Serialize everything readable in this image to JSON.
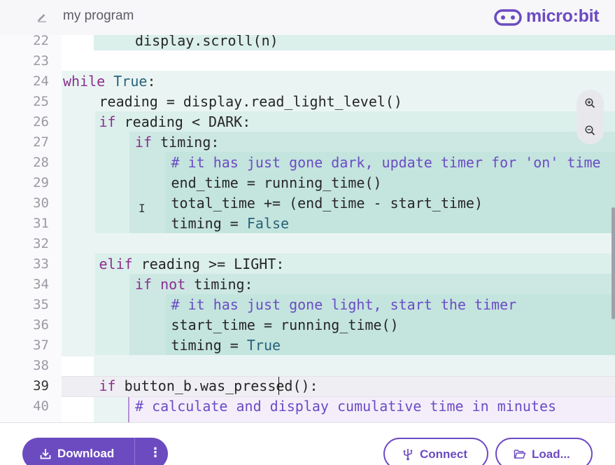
{
  "header": {
    "program_name": "my program",
    "brand": "micro:bit"
  },
  "code": [
    {
      "num": "22",
      "tokens": [
        {
          "t": "display.scroll(n)",
          "c": ""
        }
      ]
    },
    {
      "num": "23",
      "tokens": []
    },
    {
      "num": "24",
      "tokens": [
        {
          "t": "while",
          "c": "kw"
        },
        {
          "t": " ",
          "c": ""
        },
        {
          "t": "True",
          "c": "bi"
        },
        {
          "t": ":",
          "c": ""
        }
      ]
    },
    {
      "num": "25",
      "tokens": [
        {
          "t": "reading = display.read_light_level()",
          "c": ""
        }
      ]
    },
    {
      "num": "26",
      "tokens": [
        {
          "t": "if",
          "c": "kw"
        },
        {
          "t": " reading < DARK:",
          "c": ""
        }
      ]
    },
    {
      "num": "27",
      "tokens": [
        {
          "t": "if",
          "c": "kw"
        },
        {
          "t": " timing:",
          "c": ""
        }
      ]
    },
    {
      "num": "28",
      "tokens": [
        {
          "t": "# it has just gone dark, update timer for 'on' time",
          "c": "cm"
        }
      ]
    },
    {
      "num": "29",
      "tokens": [
        {
          "t": "end_time = running_time()",
          "c": ""
        }
      ]
    },
    {
      "num": "30",
      "tokens": [
        {
          "t": "total_time += (end_time - start_time)",
          "c": ""
        }
      ]
    },
    {
      "num": "31",
      "tokens": [
        {
          "t": "timing = ",
          "c": ""
        },
        {
          "t": "False",
          "c": "bi"
        }
      ]
    },
    {
      "num": "32",
      "tokens": []
    },
    {
      "num": "33",
      "tokens": [
        {
          "t": "elif",
          "c": "kw"
        },
        {
          "t": " reading >= LIGHT:",
          "c": ""
        }
      ]
    },
    {
      "num": "34",
      "tokens": [
        {
          "t": "if",
          "c": "kw"
        },
        {
          "t": " ",
          "c": ""
        },
        {
          "t": "not",
          "c": "kw"
        },
        {
          "t": " timing:",
          "c": ""
        }
      ]
    },
    {
      "num": "35",
      "tokens": [
        {
          "t": "# it has just gone light, start the timer",
          "c": "cm"
        }
      ]
    },
    {
      "num": "36",
      "tokens": [
        {
          "t": "start_time = running_time()",
          "c": ""
        }
      ]
    },
    {
      "num": "37",
      "tokens": [
        {
          "t": "timing = ",
          "c": ""
        },
        {
          "t": "True",
          "c": "bi"
        }
      ]
    },
    {
      "num": "38",
      "tokens": []
    },
    {
      "num": "39",
      "tokens": [
        {
          "t": "if",
          "c": "kw"
        },
        {
          "t": " button_b.was_pressed():",
          "c": ""
        }
      ]
    },
    {
      "num": "40",
      "tokens": [
        {
          "t": "# calculate and display cumulative time in minutes",
          "c": "cm"
        }
      ]
    }
  ],
  "active_line": "39",
  "footer": {
    "download_label": "Download",
    "more_label": "⋮",
    "connect_label": "Connect",
    "load_label": "Load..."
  },
  "colors": {
    "brand": "#6c4bc1",
    "keyword": "#8b2f8e",
    "builtin": "#28627a",
    "comment": "#6b4cc4"
  }
}
